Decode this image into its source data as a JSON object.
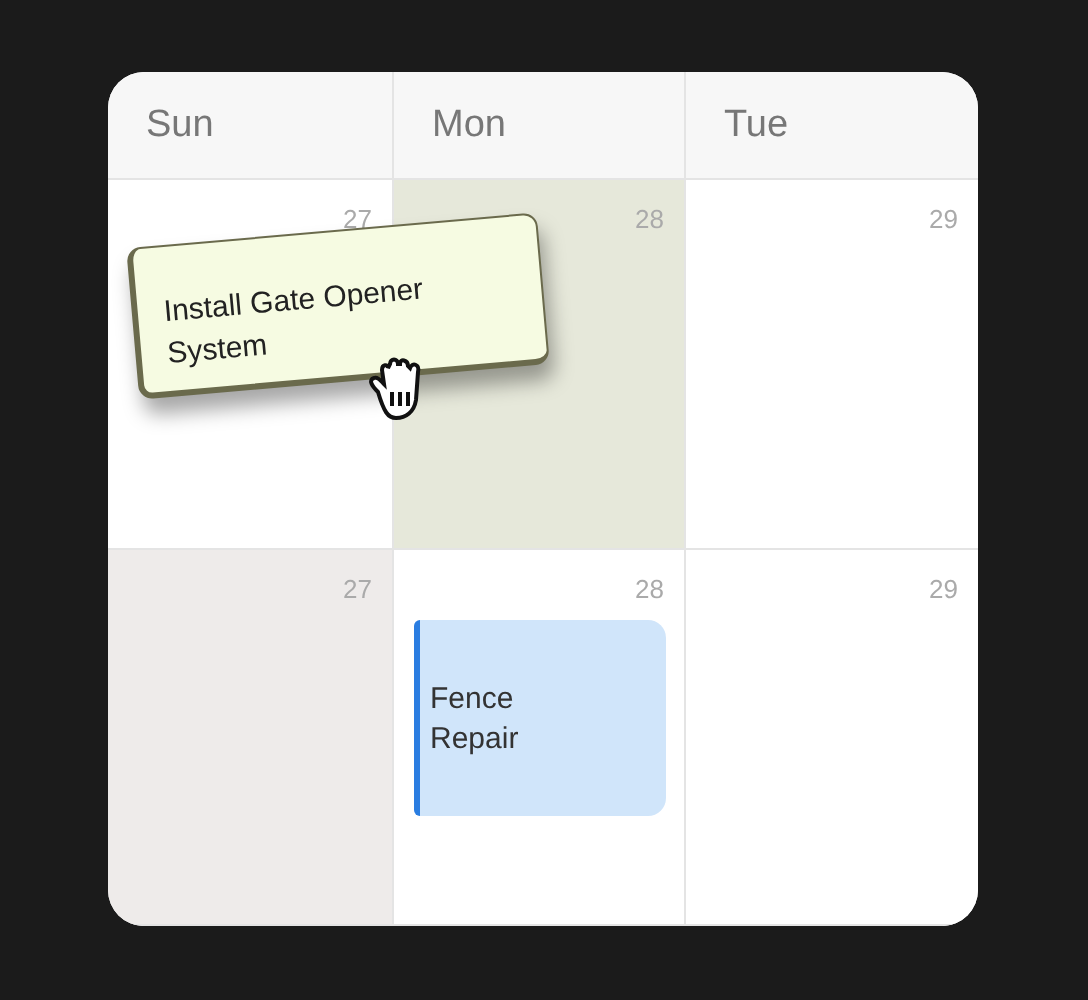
{
  "calendar": {
    "days": [
      {
        "label": "Sun"
      },
      {
        "label": "Mon"
      },
      {
        "label": "Tue"
      }
    ],
    "weeks": [
      {
        "cells": [
          {
            "date": "27",
            "kind": "normal"
          },
          {
            "date": "28",
            "kind": "drop-target"
          },
          {
            "date": "29",
            "kind": "normal"
          }
        ]
      },
      {
        "cells": [
          {
            "date": "27",
            "kind": "off"
          },
          {
            "date": "28",
            "kind": "normal",
            "events": [
              {
                "title": "Fence Repair"
              }
            ]
          },
          {
            "date": "29",
            "kind": "normal"
          }
        ]
      }
    ]
  },
  "drag_preview": {
    "title": "Install Gate Opener System"
  }
}
